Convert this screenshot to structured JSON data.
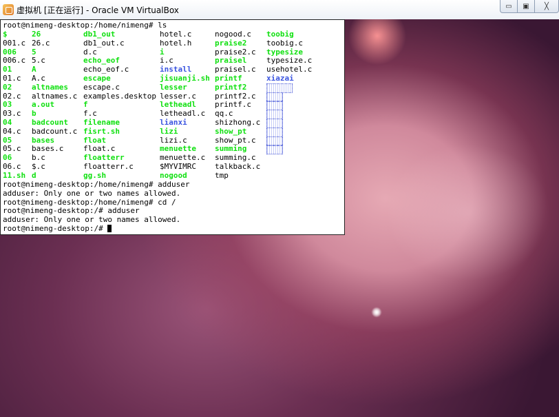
{
  "window": {
    "title": "虚拟机 [正在运行] - Oracle VM VirtualBox",
    "controls": {
      "minimize": "▭",
      "maximize": "▣",
      "close": "╳"
    }
  },
  "terminal": {
    "prompt_ls": "root@nimeng-desktop:/home/nimeng# ls",
    "ls_rows": [
      [
        {
          "t": "$",
          "c": "g"
        },
        {
          "t": "26",
          "c": "g"
        },
        {
          "t": "db1_out",
          "c": "g"
        },
        {
          "t": "hotel.c",
          "c": ""
        },
        {
          "t": "nogood.c",
          "c": ""
        },
        {
          "t": "toobig",
          "c": "g"
        }
      ],
      [
        {
          "t": "001.c",
          "c": ""
        },
        {
          "t": "26.c",
          "c": ""
        },
        {
          "t": "db1_out.c",
          "c": ""
        },
        {
          "t": "hotel.h",
          "c": ""
        },
        {
          "t": "praise2",
          "c": "g"
        },
        {
          "t": "toobig.c",
          "c": ""
        }
      ],
      [
        {
          "t": "006",
          "c": "g"
        },
        {
          "t": "5",
          "c": "g"
        },
        {
          "t": "d.c",
          "c": ""
        },
        {
          "t": "i",
          "c": "g"
        },
        {
          "t": "praise2.c",
          "c": ""
        },
        {
          "t": "typesize",
          "c": "g"
        }
      ],
      [
        {
          "t": "006.c",
          "c": ""
        },
        {
          "t": "5.c",
          "c": ""
        },
        {
          "t": "echo_eof",
          "c": "g"
        },
        {
          "t": "i.c",
          "c": ""
        },
        {
          "t": "praisel",
          "c": "g"
        },
        {
          "t": "typesize.c",
          "c": ""
        }
      ],
      [
        {
          "t": "01",
          "c": "g"
        },
        {
          "t": "A",
          "c": "g"
        },
        {
          "t": "echo_eof.c",
          "c": ""
        },
        {
          "t": "install",
          "c": "b"
        },
        {
          "t": "praisel.c",
          "c": ""
        },
        {
          "t": "usehotel.c",
          "c": ""
        }
      ],
      [
        {
          "t": "01.c",
          "c": ""
        },
        {
          "t": "A.c",
          "c": ""
        },
        {
          "t": "escape",
          "c": "g"
        },
        {
          "t": "jisuanji.sh",
          "c": "g"
        },
        {
          "t": "printf",
          "c": "g"
        },
        {
          "t": "xiazai",
          "c": "b"
        }
      ],
      [
        {
          "t": "02",
          "c": "g"
        },
        {
          "t": "altnames",
          "c": "g"
        },
        {
          "t": "escape.c",
          "c": ""
        },
        {
          "t": "lesser",
          "c": "g"
        },
        {
          "t": "printf2",
          "c": "g"
        },
        {
          "t": "",
          "c": "box"
        }
      ],
      [
        {
          "t": "02.c",
          "c": ""
        },
        {
          "t": "altnames.c",
          "c": ""
        },
        {
          "t": "examples.desktop",
          "c": ""
        },
        {
          "t": "lesser.c",
          "c": ""
        },
        {
          "t": "printf2.c",
          "c": ""
        },
        {
          "t": "",
          "c": "box"
        }
      ],
      [
        {
          "t": "03",
          "c": "g"
        },
        {
          "t": "a.out",
          "c": "g"
        },
        {
          "t": "f",
          "c": "g"
        },
        {
          "t": "letheadl",
          "c": "g"
        },
        {
          "t": "printf.c",
          "c": ""
        },
        {
          "t": "",
          "c": "box"
        }
      ],
      [
        {
          "t": "03.c",
          "c": ""
        },
        {
          "t": "b",
          "c": "g"
        },
        {
          "t": "f.c",
          "c": ""
        },
        {
          "t": "letheadl.c",
          "c": ""
        },
        {
          "t": "qq.c",
          "c": ""
        },
        {
          "t": "",
          "c": "box"
        }
      ],
      [
        {
          "t": "04",
          "c": "g"
        },
        {
          "t": "badcount",
          "c": "g"
        },
        {
          "t": "filename",
          "c": "g"
        },
        {
          "t": "lianxi",
          "c": "b"
        },
        {
          "t": "shizhong.c",
          "c": ""
        },
        {
          "t": "",
          "c": "box"
        }
      ],
      [
        {
          "t": "04.c",
          "c": ""
        },
        {
          "t": "badcount.c",
          "c": ""
        },
        {
          "t": "fisrt.sh",
          "c": "g"
        },
        {
          "t": "lizi",
          "c": "g"
        },
        {
          "t": "show_pt",
          "c": "g"
        },
        {
          "t": "",
          "c": "box"
        }
      ],
      [
        {
          "t": "05",
          "c": "g"
        },
        {
          "t": "bases",
          "c": "g"
        },
        {
          "t": "float",
          "c": "g"
        },
        {
          "t": "lizi.c",
          "c": ""
        },
        {
          "t": "show_pt.c",
          "c": ""
        },
        {
          "t": "",
          "c": "box"
        }
      ],
      [
        {
          "t": "05.c",
          "c": ""
        },
        {
          "t": "bases.c",
          "c": ""
        },
        {
          "t": "float.c",
          "c": ""
        },
        {
          "t": "menuette",
          "c": "g"
        },
        {
          "t": "summing",
          "c": "g"
        },
        {
          "t": "",
          "c": "box"
        }
      ],
      [
        {
          "t": "06",
          "c": "g"
        },
        {
          "t": "b.c",
          "c": ""
        },
        {
          "t": "floatterr",
          "c": "g"
        },
        {
          "t": "menuette.c",
          "c": ""
        },
        {
          "t": "summing.c",
          "c": ""
        },
        {
          "t": "",
          "c": ""
        }
      ],
      [
        {
          "t": "06.c",
          "c": ""
        },
        {
          "t": "$.c",
          "c": ""
        },
        {
          "t": "floatterr.c",
          "c": ""
        },
        {
          "t": "$MYVIMRC",
          "c": ""
        },
        {
          "t": "talkback.c",
          "c": ""
        },
        {
          "t": "",
          "c": ""
        }
      ],
      [
        {
          "t": "11.sh",
          "c": "g"
        },
        {
          "t": "d",
          "c": "g"
        },
        {
          "t": "gg.sh",
          "c": "g"
        },
        {
          "t": "nogood",
          "c": "g"
        },
        {
          "t": "tmp",
          "c": ""
        },
        {
          "t": "",
          "c": ""
        }
      ]
    ],
    "after_lines": [
      "root@nimeng-desktop:/home/nimeng# adduser",
      "adduser: Only one or two names allowed.",
      "root@nimeng-desktop:/home/nimeng# cd /",
      "root@nimeng-desktop:/# adduser",
      "adduser: Only one or two names allowed."
    ],
    "final_prompt": "root@nimeng-desktop:/# "
  }
}
